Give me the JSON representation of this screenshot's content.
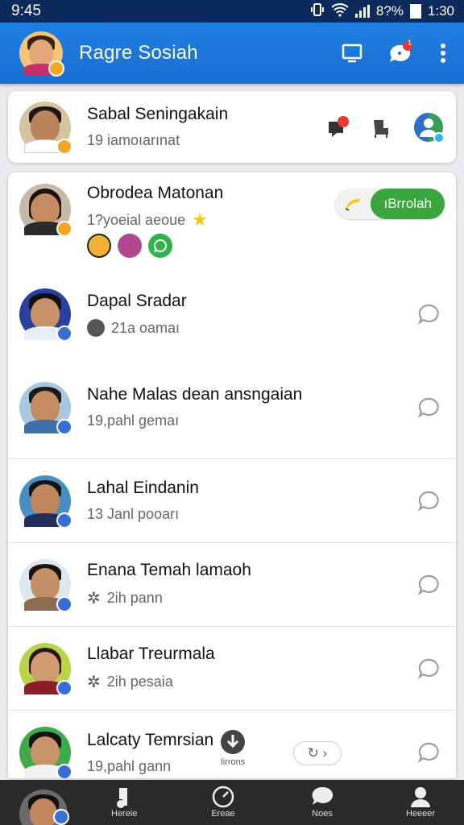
{
  "status_bar": {
    "time": "9:45",
    "battery": "8?%",
    "clock": "1:30"
  },
  "app_bar": {
    "title": "Ragre Sosiah",
    "notification_count": "1"
  },
  "pinned": {
    "name": "Sabal Seningakain",
    "subtitle": "19 iamoıarınat",
    "notification_count": "1"
  },
  "featured": {
    "name": "Obrodea Matonan",
    "subtitle": "1?yoeial aeoue",
    "action_label": "ıBrrolah"
  },
  "contacts": [
    {
      "name": "Dapal Sradar",
      "subtitle": "21a oamaı"
    },
    {
      "name": "Nahe Malas dean ansngaian",
      "subtitle": "19,pahl gemaı"
    },
    {
      "name": "Lahal Eindanin",
      "subtitle": "13 Janl poo​arı"
    },
    {
      "name": "Enana Temah lamaoh",
      "subtitle": "2ih pann"
    },
    {
      "name": "Llabar Treurmala",
      "subtitle": "2ih pesaia"
    },
    {
      "name": "Lalcaty Temrsian",
      "subtitle": "19,pahl gann"
    }
  ],
  "floating": {
    "download_label": "Iirrons"
  },
  "bottom_nav": [
    {
      "label": "Hereie"
    },
    {
      "label": "Ereae"
    },
    {
      "label": "Noes"
    },
    {
      "label": "Heeeer"
    }
  ],
  "colors": {
    "app_bar": "#1f7fe0",
    "status_bar": "#0d2a5c",
    "accent_green": "#3aa53c",
    "badge_blue": "#3b6fd8",
    "badge_orange": "#f5a623"
  },
  "icons": [
    "wifi-icon",
    "signal-icon",
    "battery-icon",
    "tablet-icon",
    "chat-bubble-icon",
    "more-vert-icon",
    "inbox-alert-icon",
    "chair-icon",
    "contact-sync-icon",
    "star-icon",
    "chat-icon",
    "download-icon",
    "home-icon",
    "explore-icon",
    "messages-icon",
    "profile-icon"
  ]
}
